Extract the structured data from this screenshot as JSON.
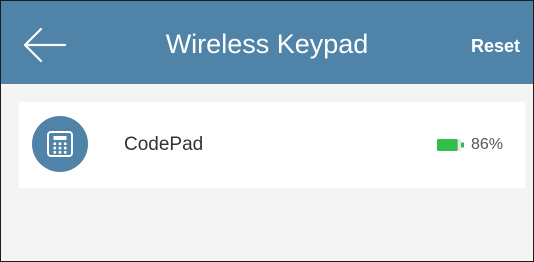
{
  "header": {
    "title": "Wireless Keypad",
    "back_icon": "arrow-left-icon",
    "reset_label": "Reset",
    "background_color": "#5083a8"
  },
  "device": {
    "name": "CodePad",
    "icon": "keypad-icon",
    "battery_icon": "battery-icon",
    "battery_percent": "86%",
    "battery_level": 0.86,
    "battery_color": "#2fbf4a"
  }
}
